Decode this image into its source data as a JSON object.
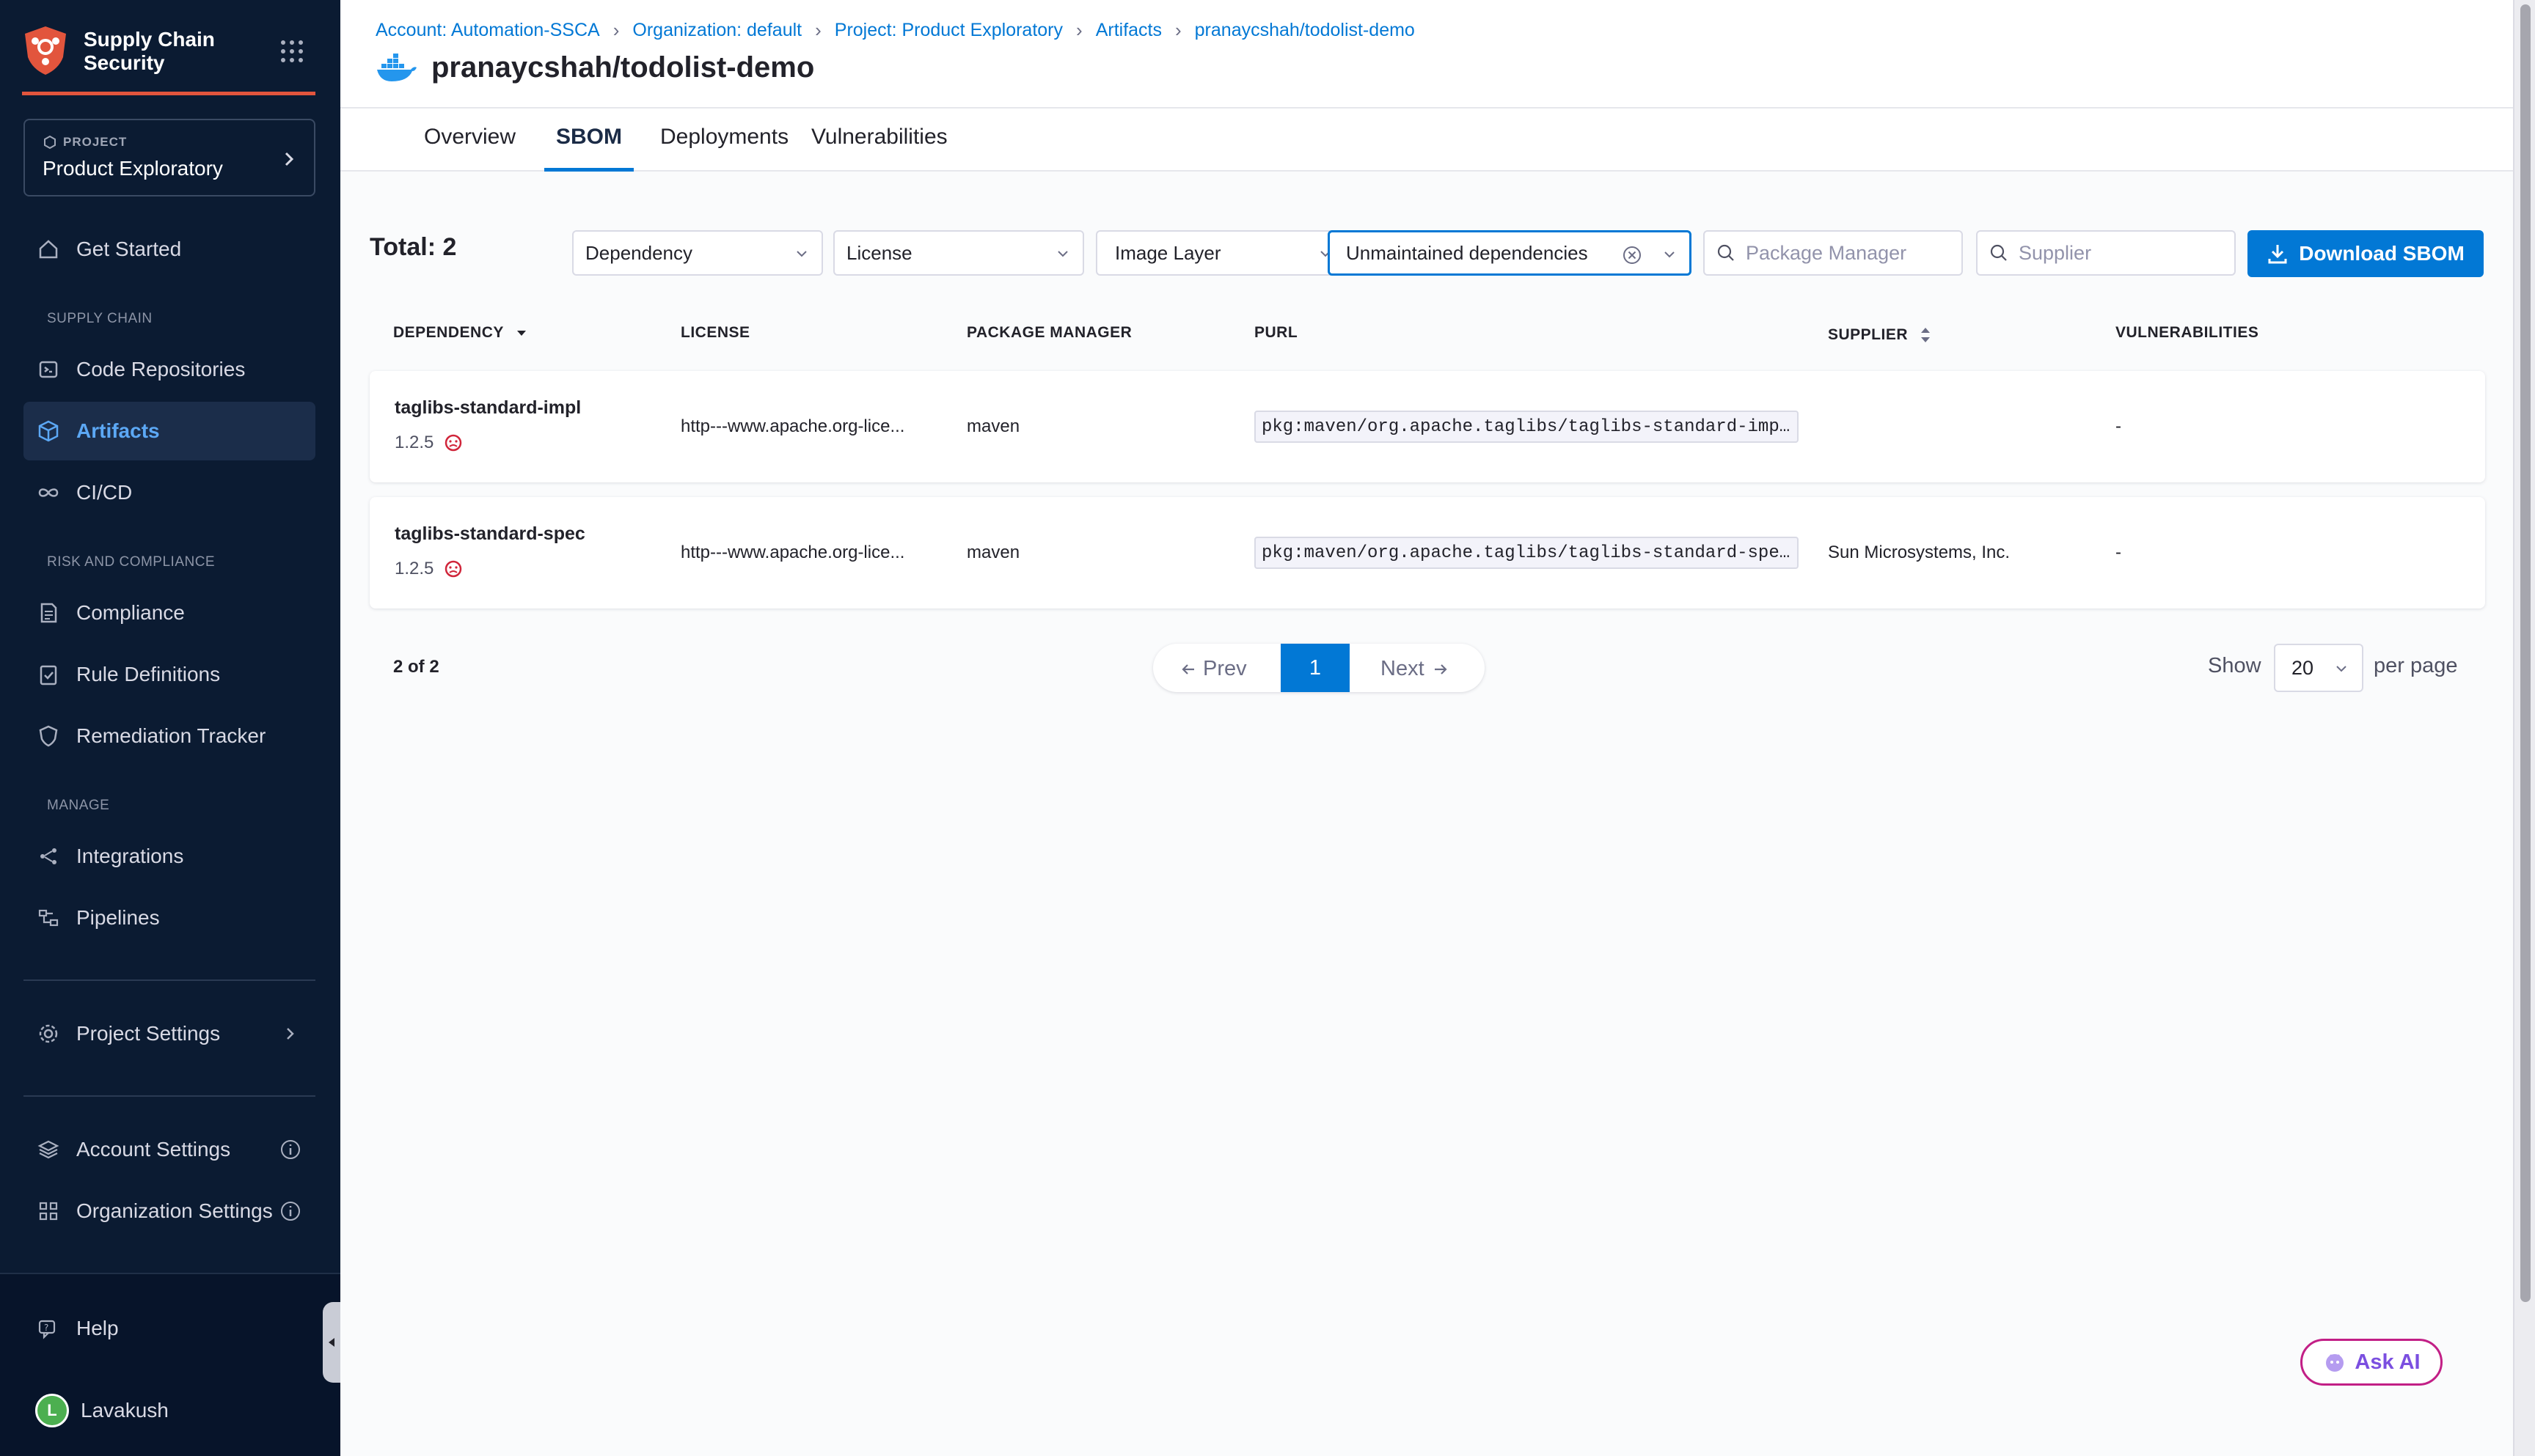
{
  "sidebar": {
    "module_title": "Supply Chain Security",
    "project_label": "PROJECT",
    "project_name": "Product Exploratory",
    "get_started": "Get Started",
    "section_supply_chain": "SUPPLY CHAIN",
    "code_repositories": "Code Repositories",
    "artifacts": "Artifacts",
    "cicd": "CI/CD",
    "section_risk": "RISK AND COMPLIANCE",
    "compliance": "Compliance",
    "rule_definitions": "Rule Definitions",
    "remediation_tracker": "Remediation Tracker",
    "section_manage": "MANAGE",
    "integrations": "Integrations",
    "pipelines": "Pipelines",
    "project_settings": "Project Settings",
    "account_settings": "Account Settings",
    "organization_settings": "Organization Settings",
    "help": "Help",
    "user_initial": "L",
    "user_name": "Lavakush"
  },
  "breadcrumb": [
    "Account: Automation-SSCA",
    "Organization: default",
    "Project: Product Exploratory",
    "Artifacts",
    "pranaycshah/todolist-demo"
  ],
  "page_title": "pranaycshah/todolist-demo",
  "tabs": [
    "Overview",
    "SBOM",
    "Deployments",
    "Vulnerabilities"
  ],
  "active_tab": "SBOM",
  "toolbar": {
    "total": "Total: 2",
    "filter_dependency": "Dependency",
    "filter_license": "License",
    "filter_image_layer": "Image Layer",
    "filter_unmaintained": "Unmaintained dependencies",
    "package_manager_placeholder": "Package Manager",
    "supplier_placeholder": "Supplier",
    "download_label": "Download SBOM"
  },
  "table": {
    "columns": [
      "DEPENDENCY",
      "LICENSE",
      "PACKAGE MANAGER",
      "PURL",
      "SUPPLIER",
      "VULNERABILITIES"
    ],
    "rows": [
      {
        "name": "taglibs-standard-impl",
        "version": "1.2.5",
        "license": "http---www.apache.org-lice...",
        "package_manager": "maven",
        "purl": "pkg:maven/org.apache.taglibs/taglibs-standard-imp…",
        "supplier": "",
        "vulnerabilities": "-"
      },
      {
        "name": "taglibs-standard-spec",
        "version": "1.2.5",
        "license": "http---www.apache.org-lice...",
        "package_manager": "maven",
        "purl": "pkg:maven/org.apache.taglibs/taglibs-standard-spe…",
        "supplier": "Sun Microsystems, Inc.",
        "vulnerabilities": "-"
      }
    ]
  },
  "pagination": {
    "count": "2 of 2",
    "prev": "Prev",
    "current_page": "1",
    "next": "Next",
    "show_label": "Show",
    "per_page_value": "20",
    "per_page_label": "per page"
  },
  "ask_ai": "Ask AI",
  "colors": {
    "sidebar_bg": "#0b1b32",
    "accent": "#0278d5",
    "brand": "#e2553d",
    "status_unmaintained": "#d0253a"
  }
}
